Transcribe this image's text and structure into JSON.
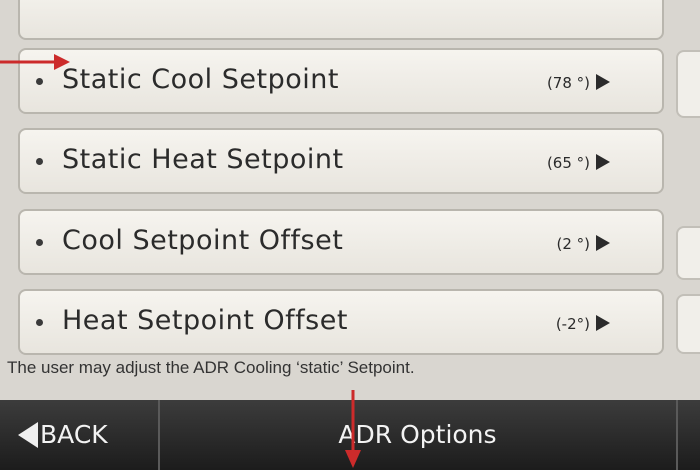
{
  "menu": {
    "items": [
      {
        "label": "Static Cool Setpoint",
        "value": "(78 °)"
      },
      {
        "label": "Static Heat Setpoint",
        "value": "(65 °)"
      },
      {
        "label": "Cool Setpoint Offset",
        "value": "(2 °)"
      },
      {
        "label": "Heat Setpoint Offset",
        "value": "(-2°)"
      }
    ]
  },
  "caption": "The user may adjust the ADR Cooling ‘static’ Setpoint.",
  "footer": {
    "back_label": "BACK",
    "title": "ADR Options"
  },
  "colors": {
    "annotation_arrow": "#cc2b2b",
    "footer_bg": "#2a2a2a",
    "screen_bg": "#d9d6d0"
  }
}
